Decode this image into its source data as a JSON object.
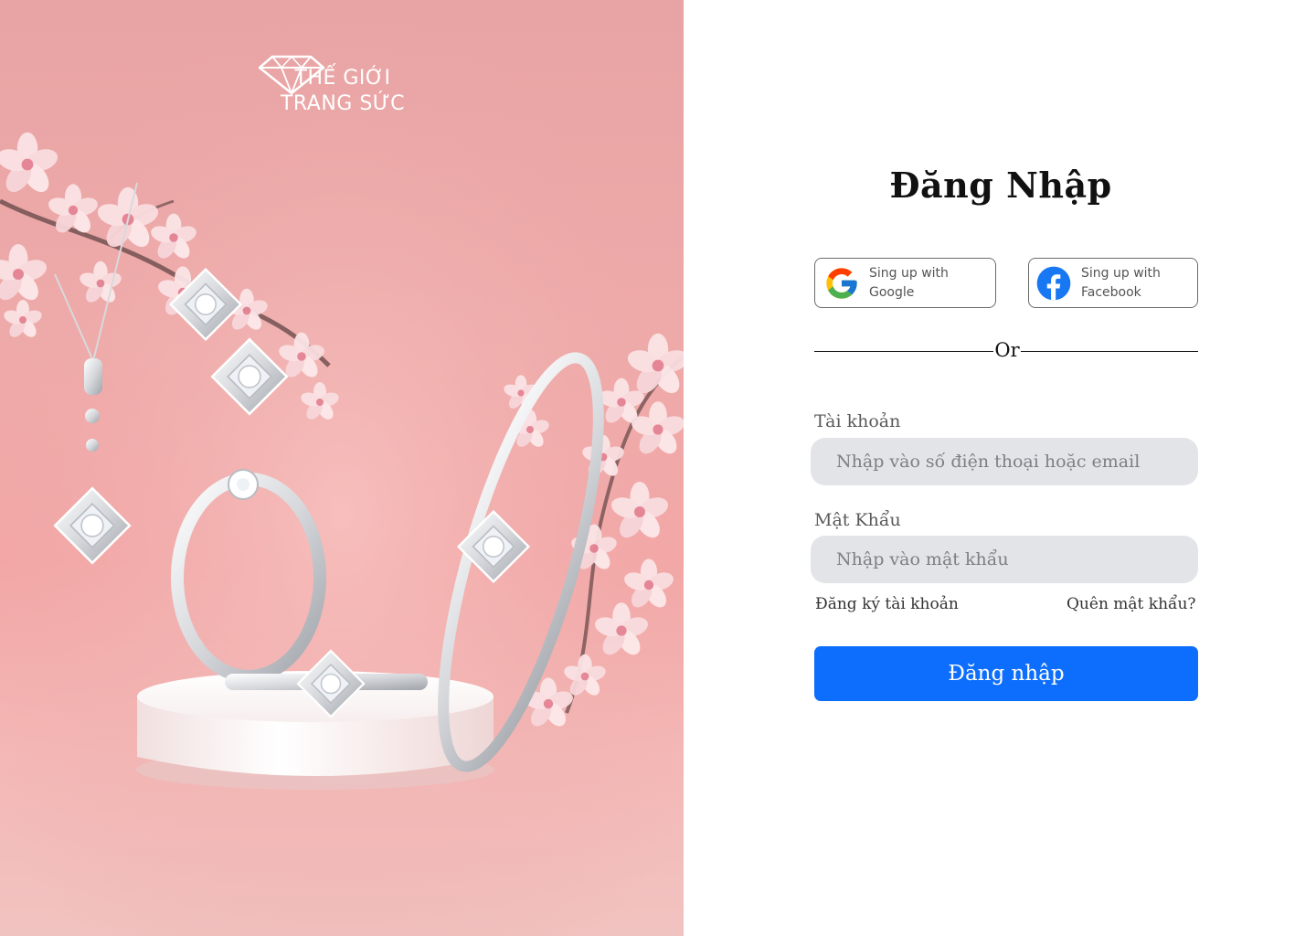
{
  "brand": {
    "line1": "THẾ GIỚI",
    "line2": "TRANG SỨC"
  },
  "login": {
    "title": "Đăng Nhập",
    "social": {
      "google_label": "Sing up with Google",
      "facebook_label": "Sing up with Facebook"
    },
    "divider_text": "Or",
    "username": {
      "label": "Tài khoản",
      "placeholder": "Nhập vào số điện thoại hoặc email"
    },
    "password": {
      "label": "Mật Khẩu",
      "placeholder": "Nhập vào mật khẩu"
    },
    "register_link": "Đăng ký tài khoản",
    "forgot_link": "Quên mật khẩu?",
    "submit_label": "Đăng nhập"
  },
  "colors": {
    "primary_button": "#0d6efd",
    "input_background": "#e2e4e8",
    "hero_pink": "#eeaaa9",
    "facebook_blue": "#1877f2"
  },
  "icons": {
    "google": "google-icon",
    "facebook": "facebook-icon",
    "brand": "diamond-logo-icon"
  }
}
